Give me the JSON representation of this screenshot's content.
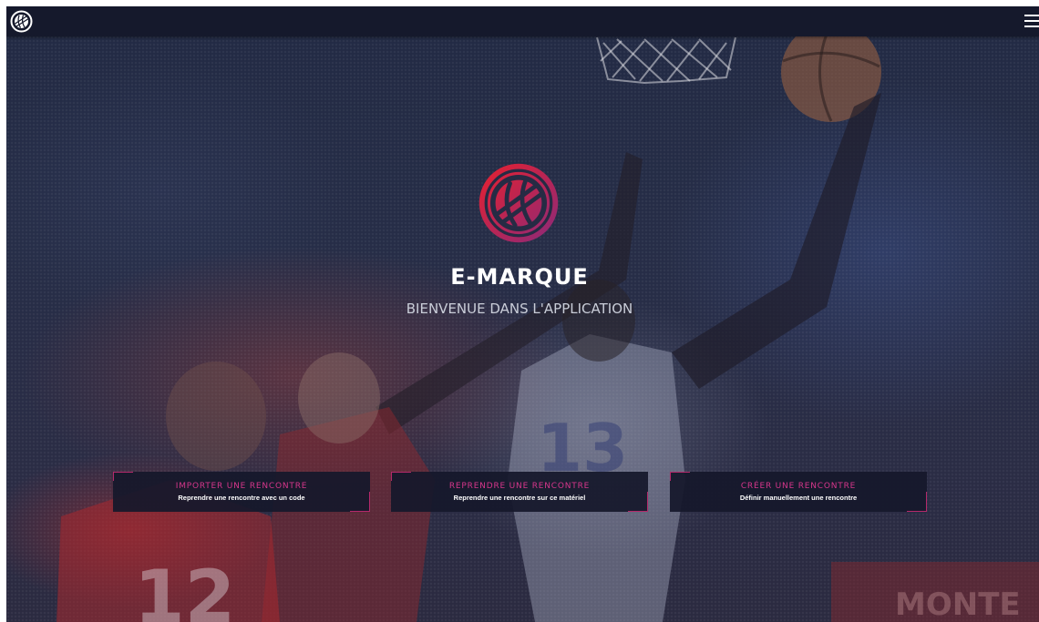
{
  "header": {
    "logo_icon": "basketball-logo-icon",
    "menu_icon": "hamburger-menu-icon"
  },
  "hero": {
    "logo_icon": "basketball-logo-icon",
    "title": "E-MARQUE",
    "subtitle": "BIENVENUE DANS L'APPLICATION"
  },
  "actions": [
    {
      "title": "IMPORTER UNE RENCONTRE",
      "description": "Reprendre une rencontre avec un code"
    },
    {
      "title": "REPRENDRE UNE RENCONTRE",
      "description": "Reprendre une rencontre sur ce matériel"
    },
    {
      "title": "CRÉER UNE RENCONTRE",
      "description": "Définir manuellement une rencontre"
    }
  ],
  "colors": {
    "accent": "#d6368b",
    "accent_border": "#b4296b",
    "logo_gradient_start": "#e8202e",
    "logo_gradient_end": "#8a2a7a",
    "topbar": "#15192c",
    "card_bg": "#16182b"
  }
}
